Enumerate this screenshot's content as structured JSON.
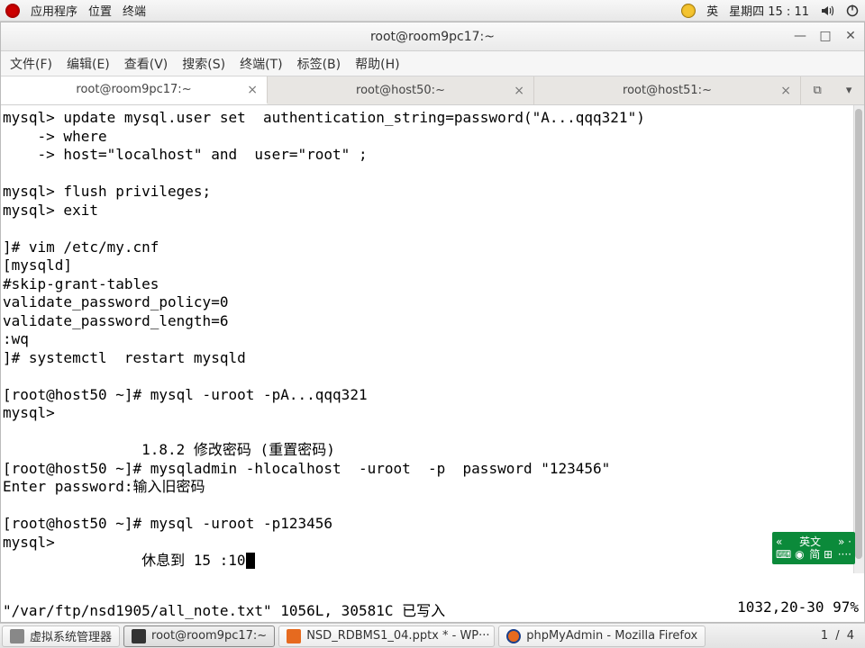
{
  "topbar": {
    "apps": "应用程序",
    "places": "位置",
    "terminal": "终端",
    "ime": "英",
    "datetime": "星期四 15 : 11"
  },
  "window": {
    "title": "root@room9pc17:~"
  },
  "menubar": {
    "file": "文件(F)",
    "edit": "编辑(E)",
    "view": "查看(V)",
    "search": "搜索(S)",
    "terminal": "终端(T)",
    "tabs": "标签(B)",
    "help": "帮助(H)"
  },
  "tabs": {
    "t1": "root@room9pc17:~",
    "t2": "root@host50:~",
    "t3": "root@host51:~"
  },
  "terminal": {
    "l01": "mysql> update mysql.user set  authentication_string=password(\"A...qqq321\")",
    "l02": "    -> where",
    "l03": "    -> host=\"localhost\" and  user=\"root\" ;",
    "l04": "",
    "l05": "mysql> flush privileges;",
    "l06": "mysql> exit",
    "l07": "",
    "l08": "]# vim /etc/my.cnf",
    "l09": "[mysqld]",
    "l10": "#skip-grant-tables",
    "l11": "validate_password_policy=0",
    "l12": "validate_password_length=6",
    "l13": ":wq",
    "l14": "]# systemctl  restart mysqld",
    "l15": "",
    "l16": "[root@host50 ~]# mysql -uroot -pA...qqq321",
    "l17": "mysql>",
    "l18": "",
    "l19": "                1.8.2 修改密码 (重置密码)",
    "l20": "[root@host50 ~]# mysqladmin -hlocalhost  -uroot  -p  password \"123456\"",
    "l21": "Enter password:输入旧密码",
    "l22": "",
    "l23": "[root@host50 ~]# mysql -uroot -p123456",
    "l24": "mysql>",
    "l25pre": "                休息到 15 :10",
    "l26": ""
  },
  "status": {
    "left": "\"/var/ftp/nsd1905/all_note.txt\" 1056L, 30581C 已写入",
    "right": "1032,20-30    97%"
  },
  "ime_badge": {
    "row1a": "«",
    "row1b": "英文",
    "row1c": "» ·",
    "row2a": "⌨ ◉",
    "row2b": "简 ⊞",
    "row2c": "····"
  },
  "taskbar": {
    "vmm": "虚拟系统管理器",
    "term": "root@room9pc17:~",
    "wps": "NSD_RDBMS1_04.pptx * - WP···",
    "firefox": "phpMyAdmin - Mozilla Firefox",
    "workspace": "1 / 4"
  }
}
